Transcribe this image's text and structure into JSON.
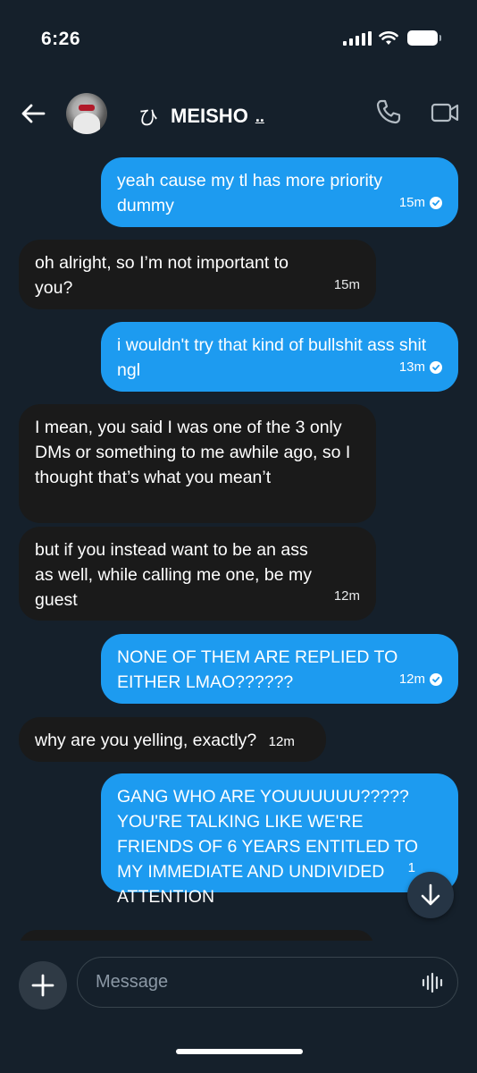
{
  "status_bar": {
    "time": "6:26"
  },
  "header": {
    "name_glyph": "ひ",
    "name": "MEISHO",
    "name_suffix": "..",
    "back_icon": "arrow-left-icon",
    "call_icon": "phone-icon",
    "video_icon": "video-camera-icon"
  },
  "messages": [
    {
      "direction": "out",
      "text": "yeah cause my tl has more priority dummy",
      "time": "15m",
      "read": true
    },
    {
      "direction": "in",
      "text": "oh alright, so I’m not important to you?",
      "time": "15m"
    },
    {
      "direction": "out",
      "text": "i wouldn't try that kind of bullshit ass shit ngl",
      "time": "13m",
      "read": true
    },
    {
      "direction": "in",
      "text": "I mean, you said I was one of the 3 only DMs or something to me awhile ago, so I thought that’s what you mean’t",
      "time": ""
    },
    {
      "direction": "in",
      "text": "but if you instead want to be an ass as well, while calling me one, be my guest",
      "time": "12m"
    },
    {
      "direction": "out",
      "text": "NONE OF THEM ARE REPLIED TO EITHER LMAO??????",
      "time": "12m",
      "read": true
    },
    {
      "direction": "in",
      "text": "why are you yelling, exactly?",
      "time": "12m"
    },
    {
      "direction": "out",
      "text": "GANG WHO ARE YOUUUUUU????? YOU'RE TALKING LIKE WE'RE FRIENDS OF 6 YEARS ENTITLED TO MY IMMEDIATE AND UNDIVIDED ATTENTION",
      "time": "1",
      "read": false
    }
  ],
  "composer": {
    "placeholder": "Message",
    "add_icon": "plus-icon",
    "voice_icon": "voice-waveform-icon"
  },
  "scroll_button": {
    "icon": "arrow-down-icon"
  },
  "colors": {
    "background": "#15202b",
    "outgoing_bubble": "#1d9bf0",
    "incoming_bubble": "#1a1a1a"
  }
}
